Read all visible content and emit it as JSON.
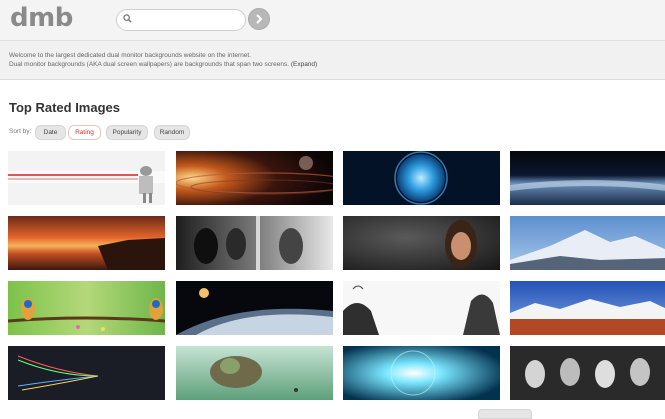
{
  "header": {
    "logo": "dmb",
    "search": {
      "value": "",
      "placeholder": ""
    }
  },
  "intro": {
    "line1": "Welcome to the largest dedicated dual monitor backgrounds website on the internet.",
    "line2": "Dual monitor backgrounds (AKA dual screen wallpapers) are backgrounds that span two screens.",
    "expand_label": "(Expand)"
  },
  "main": {
    "title": "Top Rated Images",
    "sort_label": "Sort by:",
    "sort_options": [
      "Date",
      "Rating",
      "Popularity",
      "Random"
    ],
    "active_sort": "Rating"
  },
  "colors": {
    "accent": "#c2352a",
    "logo": "#8a8a8a"
  },
  "gallery": [
    {
      "name": "red-laser-robot",
      "icon": "image-thumbnail"
    },
    {
      "name": "planet-rings",
      "icon": "image-thumbnail"
    },
    {
      "name": "blue-earth",
      "icon": "image-thumbnail"
    },
    {
      "name": "earth-horizon",
      "icon": "image-thumbnail"
    },
    {
      "name": "sunset-sea",
      "icon": "image-thumbnail"
    },
    {
      "name": "soldiers",
      "icon": "image-thumbnail"
    },
    {
      "name": "woman-portrait",
      "icon": "image-thumbnail"
    },
    {
      "name": "snowy-mountain",
      "icon": "image-thumbnail"
    },
    {
      "name": "bee-eater-birds",
      "icon": "image-thumbnail"
    },
    {
      "name": "planet-space",
      "icon": "image-thumbnail"
    },
    {
      "name": "tree-drawing",
      "icon": "image-thumbnail"
    },
    {
      "name": "mountain-desert",
      "icon": "image-thumbnail"
    },
    {
      "name": "light-lines",
      "icon": "image-thumbnail"
    },
    {
      "name": "flying-castle",
      "icon": "image-thumbnail"
    },
    {
      "name": "binary-tunnel",
      "icon": "image-thumbnail"
    },
    {
      "name": "stormtroopers",
      "icon": "image-thumbnail"
    }
  ]
}
